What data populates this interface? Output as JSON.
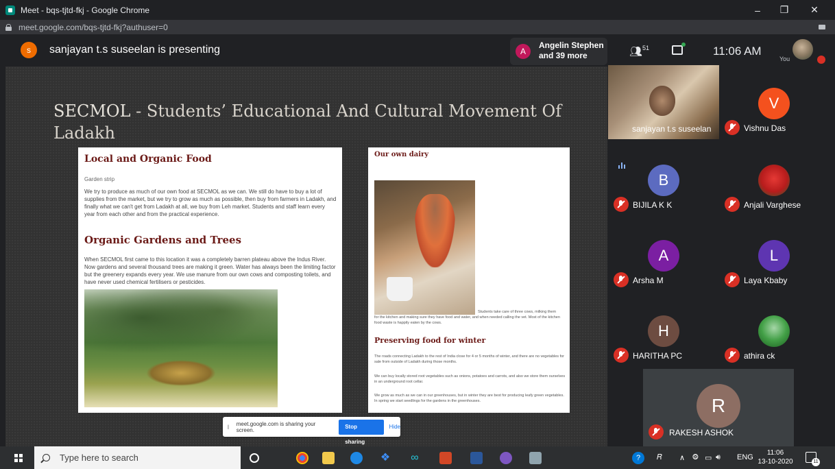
{
  "browser": {
    "tab_title": "Meet - bqs-tjtd-fkj - Google Chrome",
    "url": "meet.google.com/bqs-tjtd-fkj?authuser=0",
    "window_controls": [
      "–",
      "❐",
      "✕"
    ]
  },
  "meet": {
    "presenter_initial": "s",
    "presenting_text": "sanjayan t.s suseelan is presenting",
    "participants_pill": {
      "initial": "A",
      "line1": "Angelin Stephen",
      "line2": "and 39 more"
    },
    "people_count": "51",
    "clock": "11:06 AM",
    "you_label": "You",
    "share_bar": {
      "message": "meet.google.com is sharing your screen.",
      "stop_label": "Stop sharing",
      "hide_label": "Hide"
    }
  },
  "slide": {
    "title_acronym": "SECMOL",
    "title_rest": " - Students’ Educational And Cultural Movement Of Ladakh",
    "page1": {
      "heading1": "Local and Organic Food",
      "broken_image": "Garden strip",
      "para1": "We try to produce as much of our own food at SECMOL as we can. We still do have to buy a lot of supplies from the market, but we try to grow as much as possible, then buy from farmers in Ladakh, and finally what we can't get from Ladakh at all, we buy from Leh market. Students and staff learn every year from each other and from the practical experience.",
      "heading2": "Organic Gardens and Trees",
      "para2": "When SECMOL first came to this location it was a completely barren plateau above the Indus River. Now gardens and several thousand trees are making it green. Water has always been the limiting factor but the greenery expands every year. We use manure from our own cows and composting toilets, and have never used chemical fertilisers or pesticides."
    },
    "page2": {
      "heading1": "Our own dairy",
      "caption_right": "Students take care of three cows, milking them",
      "caption": "for the kitchen and making sure they have food and water, and when needed calling the vet. Most of the kitchen food waste is happily eaten by the cows.",
      "heading2": "Preserving food for winter",
      "para1": "The roads connecting Ladakh to the rest of India close for 4 or 5 months of winter, and there are no vegetables for sale from outside of Ladakh during those months.",
      "para2": "We can buy locally stored root vegetables such as onions, potatoes and carrots, and also we store them ourselves in an underground root cellar.",
      "para3": "We grow as much as we can in our greenhouses, but in winter they are best for producing leafy green vegetables. In spring we start seedlings for the gardens in the greenhouses."
    }
  },
  "participants": {
    "presenter_tile_name": "sanjayan t.s suseelan",
    "tiles": [
      {
        "name": "Vishnu Das",
        "initial": "V",
        "color": "#f4511e"
      },
      {
        "name": "BIJILA K K",
        "initial": "B",
        "color": "#5c6bc0"
      },
      {
        "name": "Anjali Varghese",
        "initial": "",
        "color": "#c62828"
      },
      {
        "name": "Arsha M",
        "initial": "A",
        "color": "#7b1fa2"
      },
      {
        "name": "Laya Kbaby",
        "initial": "L",
        "color": "#5e35b1"
      },
      {
        "name": "HARITHA PC",
        "initial": "H",
        "color": "#6d4c41"
      },
      {
        "name": "athira ck",
        "initial": "",
        "color": "#2e7d32"
      },
      {
        "name": "RAKESH ASHOK",
        "initial": "R",
        "color": "#8d6e63"
      }
    ]
  },
  "taskbar": {
    "search_placeholder": "Type here to search",
    "lang": "ENG",
    "time": "11:06",
    "date": "13-10-2020",
    "notif_count": "11"
  }
}
